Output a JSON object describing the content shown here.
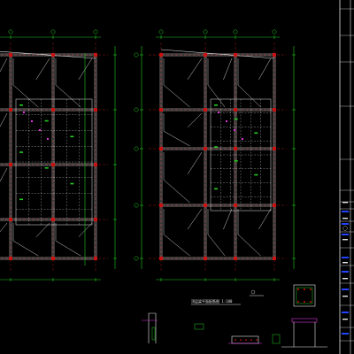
{
  "drawing": {
    "plan_note": "顶层梁平面配筋图 1:100",
    "colors": {
      "background": "#000000",
      "axis_line": "#cc2222",
      "dimension": "#22cc22",
      "beam": "#e6e6e6",
      "column": "#cc1111",
      "rebar": "#22cc22",
      "detail": "#dd33dd",
      "title_block": "#2244ff",
      "annotation": "#e8e8e8"
    }
  }
}
